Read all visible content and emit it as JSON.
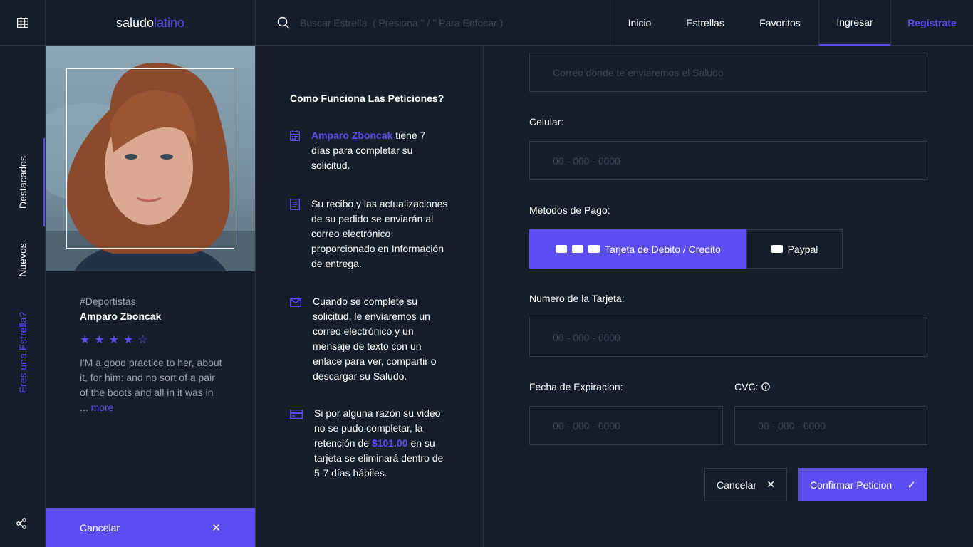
{
  "header": {
    "logo_bold": "saludo",
    "logo_accent": "latino",
    "search_placeholder": "Buscar Estrella  ( Presiona \" / \" Para Enfocar )",
    "nav": [
      "Inicio",
      "Estrellas",
      "Favoritos",
      "Ingresar",
      "Registrate"
    ]
  },
  "sidebar": {
    "tabs": [
      "Destacados",
      "Nuevos",
      "Eres una Estrella?"
    ]
  },
  "profile": {
    "category": "#Deportistas",
    "name": "Amparo Zboncak",
    "rating": 4,
    "bio": "I'M a good practice to her, about it, for him: and no sort of a pair of the boots and all in it was in ...",
    "more": "more",
    "cancel": "Cancelar"
  },
  "info": {
    "title": "Como Funciona Las Peticiones?",
    "item1_name": "Amparo Zboncak",
    "item1_rest": " tiene 7 días para completar su solicitud.",
    "item2": "Su recibo y las actualizaciones de su pedido se enviarán al correo electrónico proporcionado en Información de entrega.",
    "item3": "Cuando se complete su solicitud, le enviaremos un correo electrónico y un mensaje de texto con un enlace para ver, compartir o descargar su Saludo.",
    "item4_a": "Si por alguna razón su video no se pudo completar, la retención de ",
    "item4_price": "$101.00",
    "item4_b": " en su tarjeta se eliminará dentro de 5-7 días hábiles."
  },
  "form": {
    "email_placeholder": "Correo donde te enviaremos el Saludo",
    "phone_label": "Celular:",
    "phone_placeholder": "00 - 000 - 0000",
    "payment_label": "Metodos de Pago:",
    "pay_card": "Tarjeta de Debito / Credito",
    "pay_paypal": "Paypal",
    "card_number_label": "Numero de la Tarjeta:",
    "card_number_placeholder": "00 - 000 - 0000",
    "expiry_label": "Fecha de Expiracion:",
    "expiry_placeholder": "00 - 000 - 0000",
    "cvc_label": "CVC:",
    "cvc_placeholder": "00 - 000 - 0000",
    "cancel": "Cancelar",
    "confirm": "Confirmar Peticion"
  },
  "colors": {
    "accent": "#5b4ef0",
    "background": "#161d2b",
    "border": "#343d4e"
  }
}
